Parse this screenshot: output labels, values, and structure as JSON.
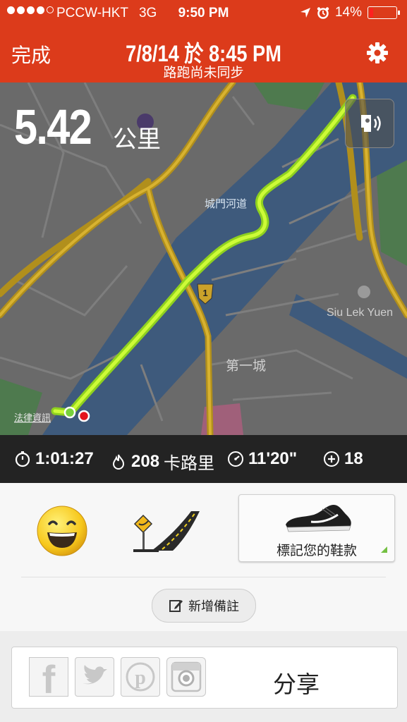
{
  "status_bar": {
    "carrier": "PCCW-HKT",
    "network": "3G",
    "time": "9:50 PM",
    "battery": "14%",
    "battery_color": "#ff2020"
  },
  "nav": {
    "done_label": "完成",
    "title": "7/8/14 於 8:45 PM",
    "subtitle": "路跑尚未同步",
    "settings_icon": "gear-icon"
  },
  "map": {
    "distance_value": "5.42",
    "distance_unit": "公里",
    "audio_icon": "audio-feedback-icon",
    "labels": {
      "river": "城門河道",
      "place": "Siu Lek Yuen",
      "district": "第一城",
      "route_marker": "1",
      "legal": "法律資訊"
    },
    "route_color": "#b6ff2e"
  },
  "stats": {
    "duration": "1:01:27",
    "calories_value": "208",
    "calories_unit": "卡路里",
    "pace": "11'20\"",
    "fuel": "18"
  },
  "feedback": {
    "mood_icon": "smiley-icon",
    "terrain_icon": "road-terrain-icon",
    "shoe_label": "標記您的鞋款",
    "add_note_label": "新增備註"
  },
  "share": {
    "label": "分享",
    "services": [
      "facebook-icon",
      "twitter-icon",
      "pinterest-icon",
      "instagram-icon"
    ]
  },
  "colors": {
    "header": "#dc3b1b",
    "stats_bar": "#232323",
    "accent_green": "#74c043"
  }
}
